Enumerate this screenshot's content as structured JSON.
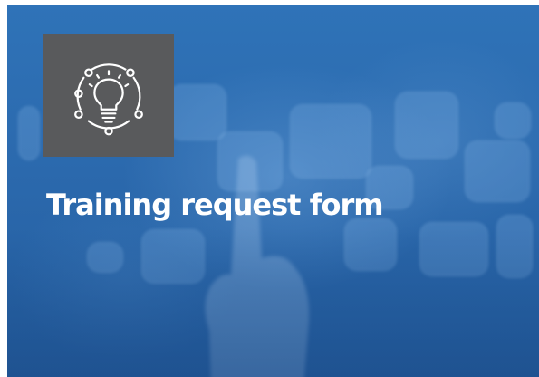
{
  "card": {
    "title": "Training request form",
    "icon": "lightbulb-network-icon"
  },
  "colors": {
    "background": "#2d6db2",
    "icon_box": "#595a5c",
    "title_text": "#ffffff"
  }
}
